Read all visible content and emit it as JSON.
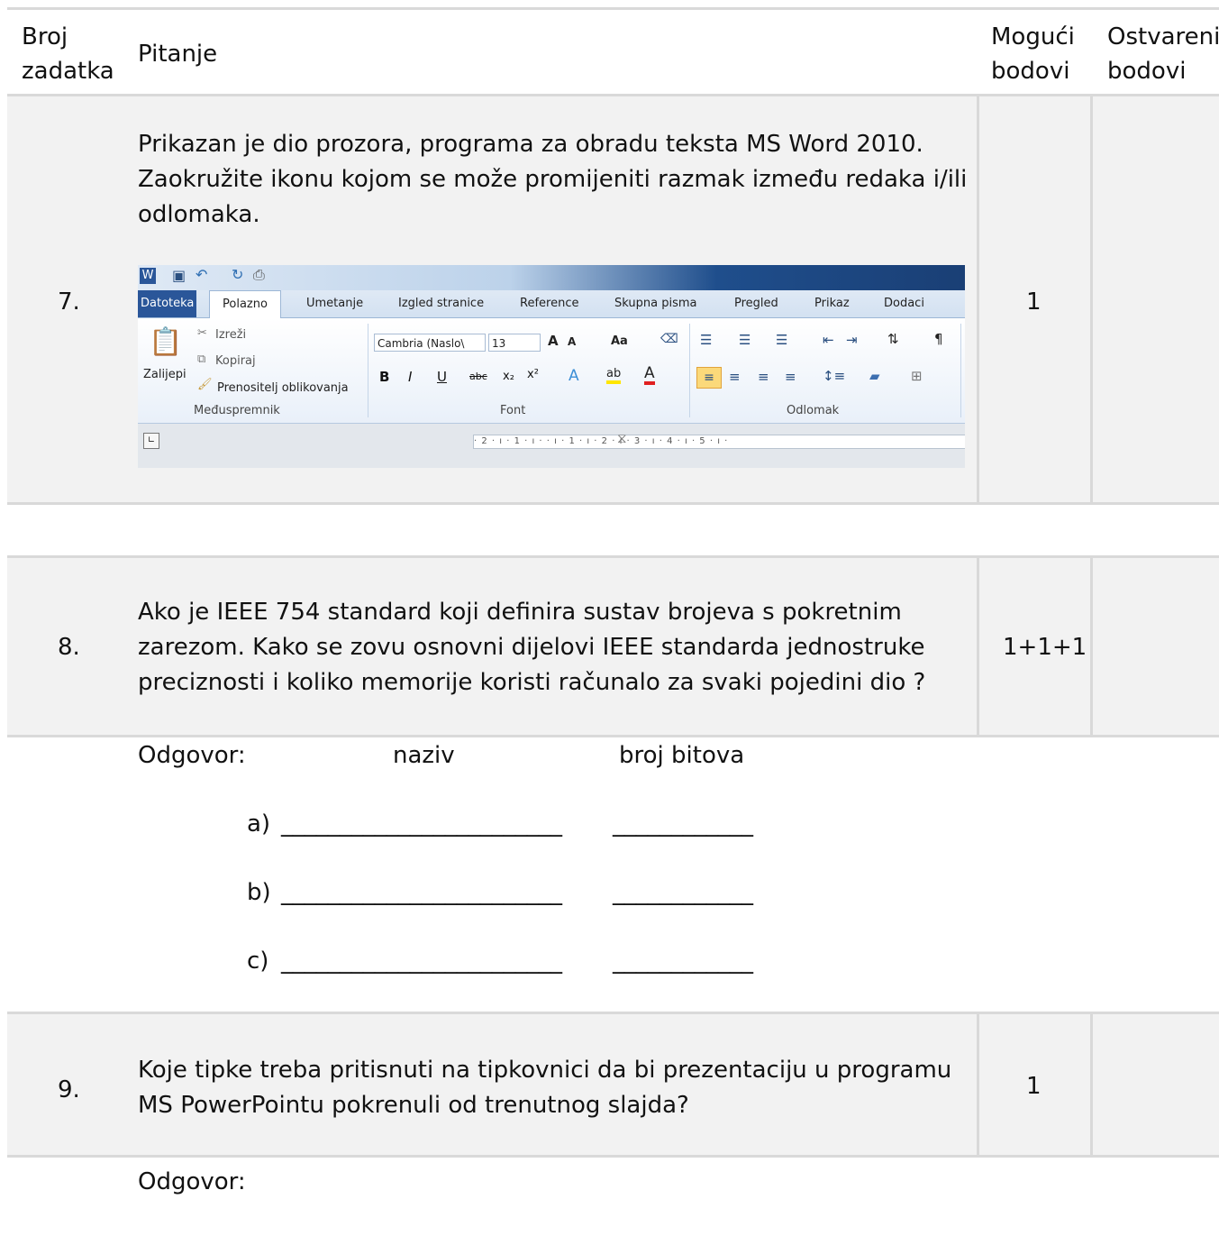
{
  "header": {
    "col1": [
      "Broj",
      "zadatka"
    ],
    "col2": "Pitanje",
    "col3": [
      "Mogući",
      "bodovi"
    ],
    "col4": [
      "Ostvareni",
      "bodovi"
    ]
  },
  "q7": {
    "number": "7.",
    "text": [
      "Prikazan je dio prozora, programa za obradu teksta MS Word 2010.",
      "Zaokružite ikonu kojom se može promijeniti razmak između redaka i/ili",
      "odlomaka."
    ],
    "points": "1",
    "ribbon": {
      "tabs": [
        "Datoteka",
        "Polazno",
        "Umetanje",
        "Izgled stranice",
        "Reference",
        "Skupna pisma",
        "Pregled",
        "Prikaz",
        "Dodaci"
      ],
      "clipboard": {
        "cut": "Izreži",
        "copy": "Kopiraj",
        "paste": "Zalijepi",
        "format_painter": "Prenositelj oblikovanja",
        "group": "Međuspremnik"
      },
      "font": {
        "name": "Cambria (Naslo\\",
        "size": "13",
        "group": "Font"
      },
      "paragraph": {
        "group": "Odlomak"
      },
      "ruler": "· 2 · ı · 1 · ı ·  · ı · 1 · ı · 2 · ı · 3 · ı · 4 · ı · 5 · ı ·"
    }
  },
  "q8": {
    "number": "8.",
    "text": [
      "Ako je IEEE 754 standard koji definira sustav brojeva s pokretnim",
      "zarezom. Kako se zovu osnovni dijelovi IEEE standarda jednostruke",
      "preciznosti i koliko memorije koristi računalo za svaki pojedini dio ?"
    ],
    "points": "1+1+1",
    "answer_label": "Odgovor:",
    "col_name": "naziv",
    "col_bits": "broj bitova",
    "rows": [
      {
        "label": "a)",
        "line1": "________________________",
        "line2": "____________"
      },
      {
        "label": "b)",
        "line1": "________________________",
        "line2": "____________"
      },
      {
        "label": "c)",
        "line1": "________________________",
        "line2": "____________"
      }
    ]
  },
  "q9": {
    "number": "9.",
    "text": [
      "Koje tipke treba pritisnuti na tipkovnici da bi prezentaciju u programu",
      "MS PowerPointu pokrenuli od trenutnog slajda?"
    ],
    "points": "1",
    "answer_label": "Odgovor:"
  }
}
